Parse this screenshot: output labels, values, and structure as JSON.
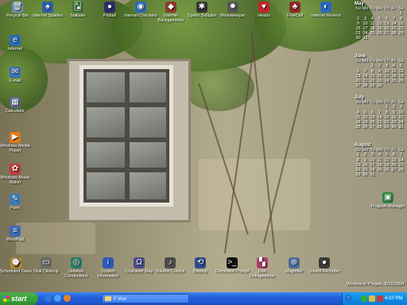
{
  "desktop_icons": {
    "top_row": [
      {
        "label": "Recycle Bin",
        "glyph": "🗑",
        "color": "#6d8fb0"
      },
      {
        "label": "Internet Spades",
        "glyph": "♠",
        "color": "#2d5da8"
      },
      {
        "label": "Solitaire",
        "glyph": "🂡",
        "color": "#3a7a3a"
      },
      {
        "label": "Pinball",
        "glyph": "●",
        "color": "#2b2b6a"
      },
      {
        "label": "Internet Checkers",
        "glyph": "◉",
        "color": "#2a6ab8"
      },
      {
        "label": "Internet Backgammon",
        "glyph": "◆",
        "color": "#8a3a2a"
      },
      {
        "label": "Spider Solitaire",
        "glyph": "✱",
        "color": "#333"
      },
      {
        "label": "Minesweeper",
        "glyph": "✹",
        "color": "#555"
      },
      {
        "label": "Hearts",
        "glyph": "♥",
        "color": "#c0242a"
      },
      {
        "label": "FreeCell",
        "glyph": "♣",
        "color": "#8a2a2a"
      },
      {
        "label": "Internet Reversi",
        "glyph": "◐",
        "color": "#2a6ab8"
      }
    ],
    "left_column": [
      {
        "label": "Internet",
        "glyph": "e",
        "color": "#2a6ab8"
      },
      {
        "label": "E-mail",
        "glyph": "✉",
        "color": "#3a70b8"
      },
      {
        "label": "Calculator",
        "glyph": "▦",
        "color": "#5a6a8a"
      },
      {
        "label": "Windows Media Player",
        "glyph": "▶",
        "color": "#e27a1a"
      },
      {
        "label": "Windows Movie Maker",
        "glyph": "✿",
        "color": "#c23a3a"
      },
      {
        "label": "Paint",
        "glyph": "✎",
        "color": "#3a7ab8"
      },
      {
        "label": "WordPad",
        "glyph": "≡",
        "color": "#3a6ab8"
      }
    ],
    "bottom_row": [
      {
        "label": "Scheduled Tasks",
        "glyph": "⌚",
        "color": "#b88a2a"
      },
      {
        "label": "Disk Cleanup",
        "glyph": "▭",
        "color": "#6a6a6a"
      },
      {
        "label": "Network Connections",
        "glyph": "◎",
        "color": "#2a7a6a"
      },
      {
        "label": "System Information",
        "glyph": "i",
        "color": "#2a5ab8"
      },
      {
        "label": "Character Map",
        "glyph": "Ω",
        "color": "#4a4a8a"
      },
      {
        "label": "Volume Control",
        "glyph": "♪",
        "color": "#4a4a4a"
      },
      {
        "label": "Backup",
        "glyph": "⟲",
        "color": "#2a4a8a"
      },
      {
        "label": "Command Prompt",
        "glyph": ">_",
        "color": "#111"
      },
      {
        "label": "Disk Defragmenter",
        "glyph": "▚",
        "color": "#a83a6a"
      },
      {
        "label": "Magnifier",
        "glyph": "⊕",
        "color": "#4a6a9a"
      },
      {
        "label": "Sound Recorder",
        "glyph": "●",
        "color": "#3a3a3a"
      }
    ],
    "right_icon": {
      "label": "Program Manager",
      "glyph": "▣",
      "color": "#2a8a3a"
    }
  },
  "calendars": [
    {
      "month": "May",
      "days": [
        "Su",
        "Mo",
        "Tu",
        "We",
        "Th",
        "Fr",
        "Sa"
      ],
      "weeks": [
        [
          "",
          "",
          "",
          "",
          "",
          "",
          "1"
        ],
        [
          "2",
          "3",
          "4",
          "5",
          "6",
          "7",
          "8"
        ],
        [
          "9",
          "10",
          "11",
          "12",
          "13",
          "14",
          "15"
        ],
        [
          "16",
          "17",
          "18",
          "19",
          "20",
          "21",
          "22"
        ],
        [
          "23",
          "24",
          "25",
          "26",
          "27",
          "28",
          "29"
        ],
        [
          "30",
          "31",
          "",
          "",
          "",
          "",
          ""
        ]
      ]
    },
    {
      "month": "June",
      "days": [
        "Su",
        "Mo",
        "Tu",
        "We",
        "Th",
        "Fr",
        "Sa"
      ],
      "weeks": [
        [
          "",
          "",
          "1",
          "2",
          "3",
          "4",
          "5"
        ],
        [
          "6",
          "7",
          "8",
          "9",
          "10",
          "11",
          "12"
        ],
        [
          "13",
          "14",
          "15",
          "16",
          "17",
          "18",
          "19"
        ],
        [
          "20",
          "21",
          "22",
          "23",
          "24",
          "25",
          "26"
        ],
        [
          "27",
          "28",
          "29",
          "30",
          "",
          "",
          ""
        ]
      ]
    },
    {
      "month": "July",
      "days": [
        "Su",
        "Mo",
        "Tu",
        "We",
        "Th",
        "Fr",
        "Sa"
      ],
      "weeks": [
        [
          "",
          "",
          "",
          "",
          "1",
          "2",
          "3"
        ],
        [
          "4",
          "5",
          "6",
          "7",
          "8",
          "9",
          "10"
        ],
        [
          "11",
          "12",
          "13",
          "14",
          "15",
          "16",
          "17"
        ],
        [
          "18",
          "19",
          "20",
          "21",
          "22",
          "23",
          "24"
        ],
        [
          "25",
          "26",
          "27",
          "28",
          "29",
          "30",
          "31"
        ]
      ]
    },
    {
      "month": "August",
      "days": [
        "Su",
        "Mo",
        "Tu",
        "We",
        "Th",
        "Fr",
        "Sa"
      ],
      "weeks": [
        [
          "1",
          "2",
          "3",
          "4",
          "5",
          "6",
          "7"
        ],
        [
          "8",
          "9",
          "10",
          "11",
          "12",
          "13",
          "14"
        ],
        [
          "15",
          "16",
          "17",
          "18",
          "19",
          "20",
          "21"
        ],
        [
          "22",
          "23",
          "24",
          "25",
          "26",
          "27",
          "28"
        ],
        [
          "29",
          "30",
          "31",
          "",
          "",
          "",
          ""
        ]
      ]
    }
  ],
  "location_text": "Window in Prague, 6/15/2004",
  "taskbar": {
    "start_label": "start",
    "task_label": "F:\\Kor",
    "clock": "4:10 PM"
  }
}
